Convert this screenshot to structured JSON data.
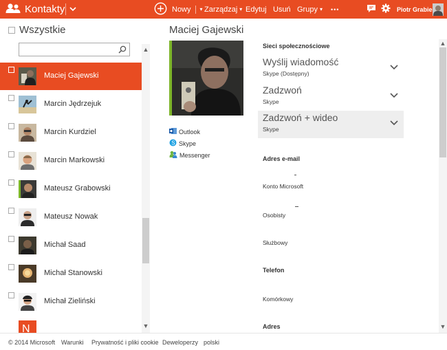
{
  "topbar": {
    "app_title": "Kontakty",
    "accent_color": "#e84c22",
    "new_label": "Nowy",
    "manage_label": "Zarządzaj",
    "edit_label": "Edytuj",
    "delete_label": "Usuń",
    "groups_label": "Grupy",
    "more_label": "•••",
    "user_name": "Piotr Grabiec",
    "icons": [
      "people-icon",
      "app-chevron-icon",
      "add-circle-icon",
      "chat-icon",
      "gear-icon"
    ]
  },
  "left": {
    "select_all_label": "Wszystkie",
    "search_placeholder": "",
    "contacts": [
      {
        "name": "Maciej Gajewski",
        "selected": true
      },
      {
        "name": "Marcin Jędrzejuk",
        "selected": false
      },
      {
        "name": "Marcin Kurdziel",
        "selected": false
      },
      {
        "name": "Marcin Markowski",
        "selected": false
      },
      {
        "name": "Mateusz Grabowski",
        "selected": false
      },
      {
        "name": "Mateusz Nowak",
        "selected": false
      },
      {
        "name": "Michał Saad",
        "selected": false
      },
      {
        "name": "Michał Stanowski",
        "selected": false
      },
      {
        "name": "Michał Zieliński",
        "selected": false
      },
      {
        "name": "N",
        "selected": false
      }
    ]
  },
  "profile": {
    "name": "Maciej Gajewski",
    "sources": [
      "Outlook",
      "Skype",
      "Messenger"
    ]
  },
  "details": {
    "social_title": "Sieci społecznościowe",
    "actions": [
      {
        "main": "Wyślij wiadomość",
        "sub": "Skype (Dostępny)"
      },
      {
        "main": "Zadzwoń",
        "sub": "Skype"
      },
      {
        "main": "Zadzwoń + wideo",
        "sub": "Skype"
      }
    ],
    "email_title": "Adres e-mail",
    "email_fields": [
      "Konto Microsoft",
      "Osobisty",
      "Służbowy"
    ],
    "phone_title": "Telefon",
    "phone_fields": [
      "Komórkowy"
    ],
    "address_title": "Adres"
  },
  "footer": {
    "copyright": "© 2014 Microsoft",
    "terms": "Warunki",
    "privacy": "Prywatność i pliki cookie",
    "developers": "Deweloperzy",
    "language": "polski"
  }
}
